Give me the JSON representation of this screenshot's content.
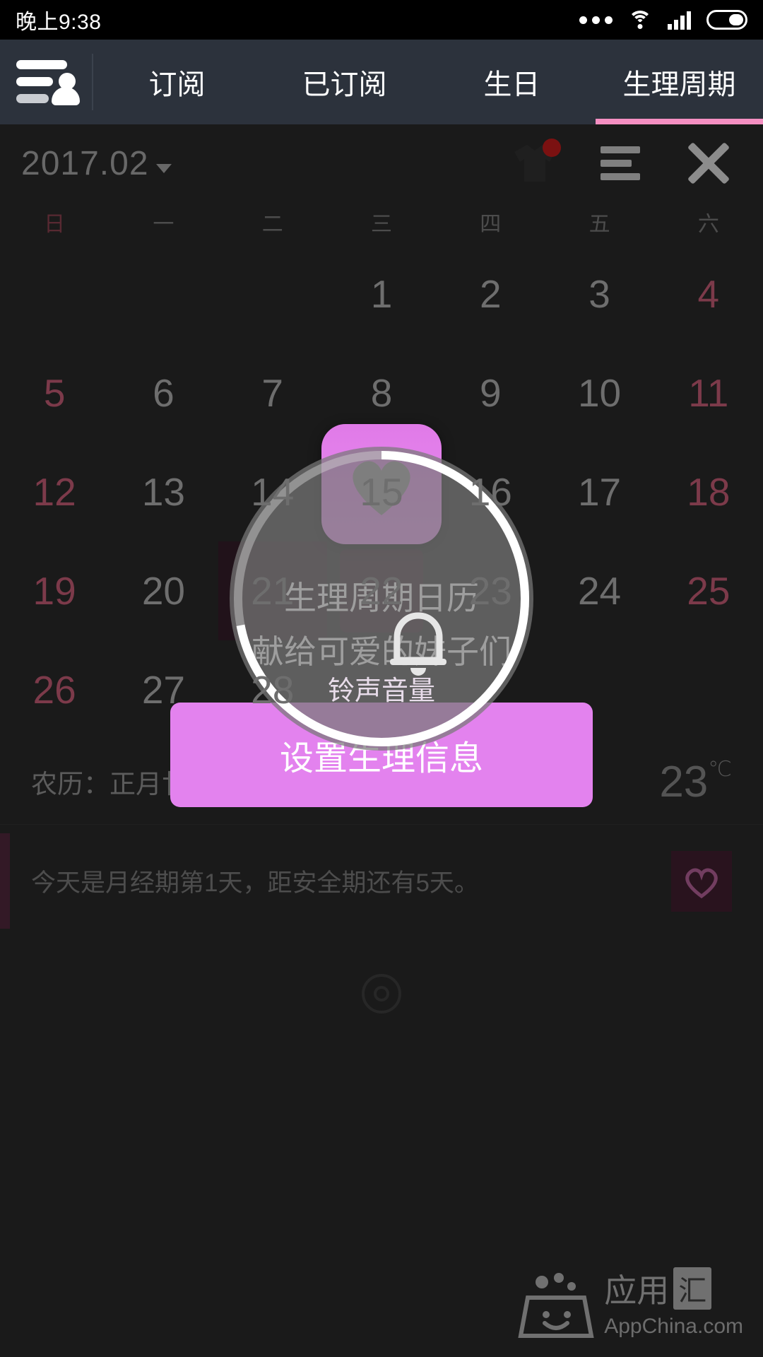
{
  "status_bar": {
    "time": "晚上9:38",
    "icons": [
      "more-dots-icon",
      "wifi-icon",
      "signal-icon",
      "battery-icon"
    ]
  },
  "tabbar": {
    "menu_icon": "menu-user-icon",
    "tabs": [
      {
        "label": "订阅",
        "active": false
      },
      {
        "label": "已订阅",
        "active": false
      },
      {
        "label": "生日",
        "active": false
      },
      {
        "label": "生理周期",
        "active": true
      }
    ],
    "active_color": "#f58fc2"
  },
  "calendar": {
    "month_label": "2017.02",
    "icons": [
      "tshirt-icon",
      "list-icon",
      "close-icon"
    ],
    "has_badge": true,
    "weekdays": [
      "日",
      "一",
      "二",
      "三",
      "四",
      "五",
      "六"
    ],
    "days": [
      "",
      "",
      "",
      "1",
      "2",
      "3",
      "4",
      "5",
      "6",
      "7",
      "8",
      "9",
      "10",
      "11",
      "12",
      "13",
      "14",
      "15",
      "16",
      "17",
      "18",
      "19",
      "20",
      "21",
      "22",
      "23",
      "24",
      "25",
      "26",
      "27",
      "28",
      "",
      "",
      "",
      ""
    ],
    "highlighted_day": "21",
    "selected_day": "22",
    "lunar_label": "农历：正月廿五",
    "temperature": "23",
    "temperature_unit": "℃",
    "note": "今天是月经期第1天，距安全期还有5天。",
    "note_icon": "heart-icon",
    "dock_icon": "target-icon"
  },
  "dialog": {
    "app_icon": "heart-app-icon",
    "title": "生理周期日历",
    "subtitle": "献给可爱的妹子们",
    "button_label": "设置生理信息",
    "button_color": "#e382ee"
  },
  "volume_overlay": {
    "label": "铃声音量",
    "icon": "bell-icon",
    "level_percent": 72
  },
  "watermark": {
    "cn_left": "应用",
    "cn_badge": "汇",
    "en": "AppChina.com",
    "logo": "appchina-logo"
  }
}
